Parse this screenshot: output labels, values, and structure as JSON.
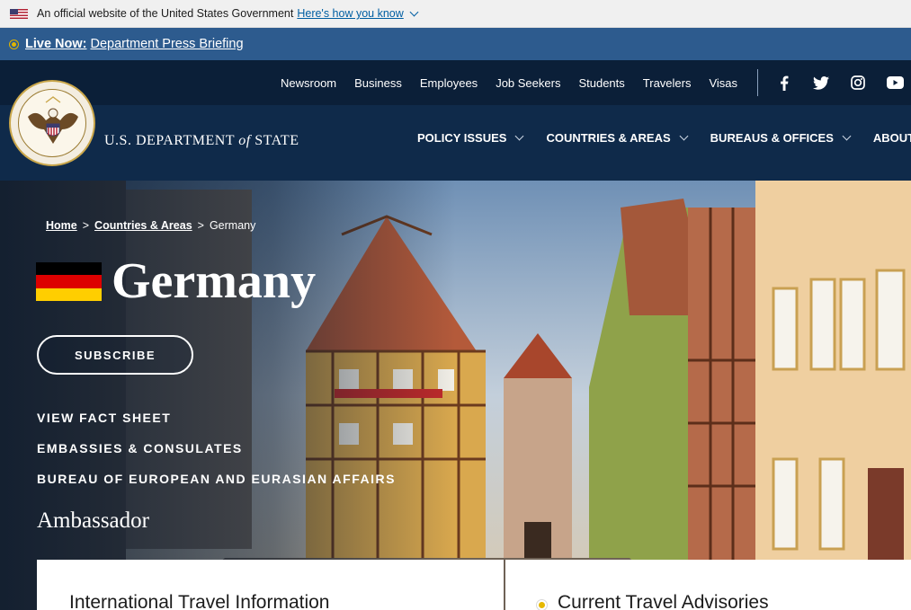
{
  "gov_banner": {
    "text": "An official website of the United States Government",
    "link": "Here's how you know"
  },
  "live_bar": {
    "label": "Live Now:",
    "text": "Department Press Briefing"
  },
  "header": {
    "brand_prefix": "U.S. DEPARTMENT",
    "brand_of": "of",
    "brand_suffix": "STATE",
    "top_nav": [
      "Newsroom",
      "Business",
      "Employees",
      "Job Seekers",
      "Students",
      "Travelers",
      "Visas"
    ],
    "social": [
      "facebook-icon",
      "twitter-icon",
      "instagram-icon",
      "youtube-icon"
    ],
    "main_nav": [
      "POLICY ISSUES",
      "COUNTRIES & AREAS",
      "BUREAUS & OFFICES",
      "ABOUT"
    ]
  },
  "hero": {
    "breadcrumb": [
      "Home",
      "Countries & Areas",
      "Germany"
    ],
    "breadcrumb_sep": ">",
    "title": "Germany",
    "subscribe": "SUBSCRIBE",
    "links": [
      "VIEW FACT SHEET",
      "EMBASSIES & CONSULATES",
      "BUREAU OF EUROPEAN AND EURASIAN AFFAIRS"
    ],
    "ambassador": "Ambassador",
    "flag_colors": [
      "#000000",
      "#dd0000",
      "#ffce00"
    ]
  },
  "cards": {
    "left_title": "International Travel Information",
    "right_title": "Current Travel Advisories"
  },
  "colors": {
    "header_bg": "#0f2a4a",
    "live_bar_bg": "#2d5b8e",
    "gov_banner_bg": "#f0f0f0"
  }
}
